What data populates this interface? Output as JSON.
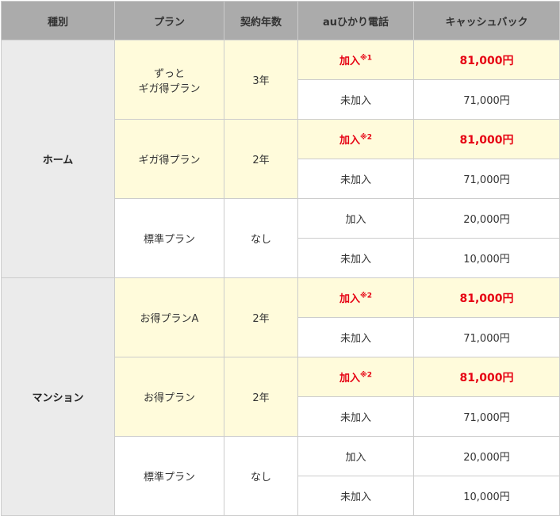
{
  "headers": {
    "type": "種別",
    "plan": "プラン",
    "term": "契約年数",
    "phone": "auひかり電話",
    "cashback": "キャッシュバック"
  },
  "groups": [
    {
      "type": "ホーム",
      "plans": [
        {
          "name_line1": "ずっと",
          "name_line2": "ギガ得プラン",
          "term": "3年",
          "rows": [
            {
              "phone": "加入",
              "note": "※1",
              "amount": "81,000円"
            },
            {
              "phone": "未加入",
              "note": "",
              "amount": "71,000円"
            }
          ]
        },
        {
          "name_line1": "ギガ得プラン",
          "term": "2年",
          "rows": [
            {
              "phone": "加入",
              "note": "※2",
              "amount": "81,000円"
            },
            {
              "phone": "未加入",
              "note": "",
              "amount": "71,000円"
            }
          ]
        },
        {
          "name_line1": "標準プラン",
          "term": "なし",
          "rows": [
            {
              "phone": "加入",
              "note": "",
              "amount": "20,000円"
            },
            {
              "phone": "未加入",
              "note": "",
              "amount": "10,000円"
            }
          ]
        }
      ]
    },
    {
      "type": "マンション",
      "plans": [
        {
          "name_line1": "お得プランA",
          "term": "2年",
          "rows": [
            {
              "phone": "加入",
              "note": "※2",
              "amount": "81,000円"
            },
            {
              "phone": "未加入",
              "note": "",
              "amount": "71,000円"
            }
          ]
        },
        {
          "name_line1": "お得プラン",
          "term": "2年",
          "rows": [
            {
              "phone": "加入",
              "note": "※2",
              "amount": "81,000円"
            },
            {
              "phone": "未加入",
              "note": "",
              "amount": "71,000円"
            }
          ]
        },
        {
          "name_line1": "標準プラン",
          "term": "なし",
          "rows": [
            {
              "phone": "加入",
              "note": "",
              "amount": "20,000円"
            },
            {
              "phone": "未加入",
              "note": "",
              "amount": "10,000円"
            }
          ]
        }
      ]
    }
  ],
  "colors": {
    "header_bg": "#ababab",
    "type_bg": "#ebebeb",
    "highlight_bg": "#fffbdb",
    "highlight_text": "#e60012",
    "border": "#cccccc"
  }
}
